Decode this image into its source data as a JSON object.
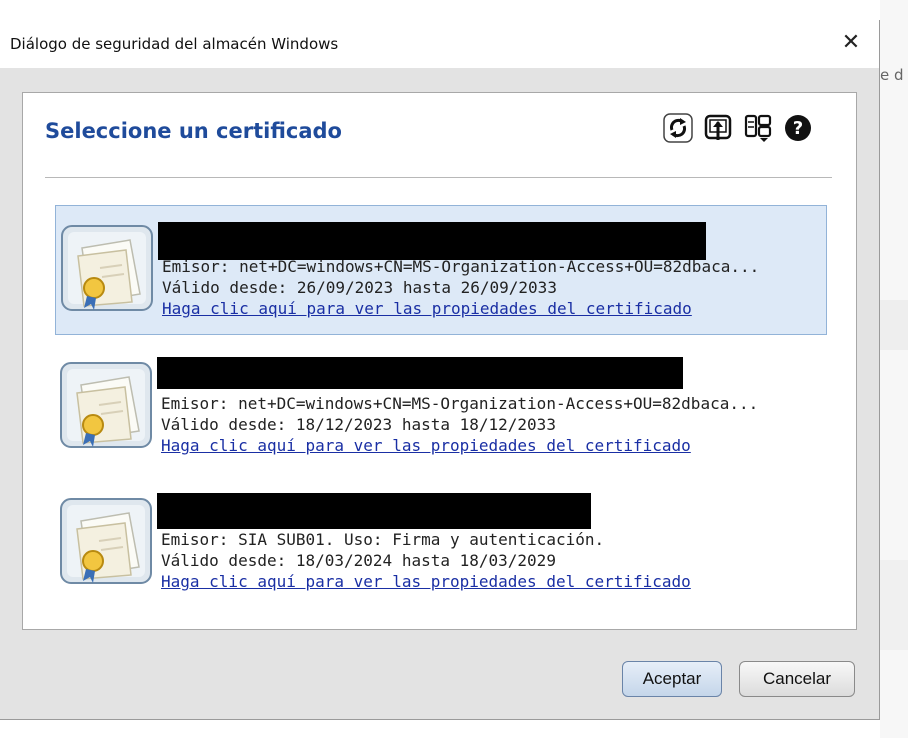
{
  "window": {
    "title": "Diálogo de seguridad del almacén Windows",
    "close_glyph": "✕"
  },
  "background": {
    "partial_text": "e d"
  },
  "dialog": {
    "heading": "Seleccione un certificado"
  },
  "toolbar": {
    "icons": [
      "refresh-icon",
      "import-icon",
      "details-icon",
      "help-icon"
    ]
  },
  "certificates": [
    {
      "issuer": "Emisor: net+DC=windows+CN=MS-Organization-Access+OU=82dbaca...",
      "validity": "Válido desde: 26/09/2023 hasta 26/09/2033",
      "link": "Haga clic aquí para ver las propiedades del certificado",
      "selected": true
    },
    {
      "issuer": "Emisor: net+DC=windows+CN=MS-Organization-Access+OU=82dbaca...",
      "validity": "Válido desde: 18/12/2023 hasta 18/12/2033",
      "link": "Haga clic aquí para ver las propiedades del certificado",
      "selected": false
    },
    {
      "issuer": "Emisor: SIA SUB01. Uso: Firma y autenticación.",
      "validity": "Válido desde: 18/03/2024 hasta 18/03/2029",
      "link": "Haga clic aquí para ver las propiedades del certificado",
      "selected": false
    }
  ],
  "buttons": {
    "ok": "Aceptar",
    "cancel": "Cancelar"
  },
  "colors": {
    "heading": "#1f4b9b",
    "selection": "#dde9f7",
    "link": "#1a2fa4"
  }
}
